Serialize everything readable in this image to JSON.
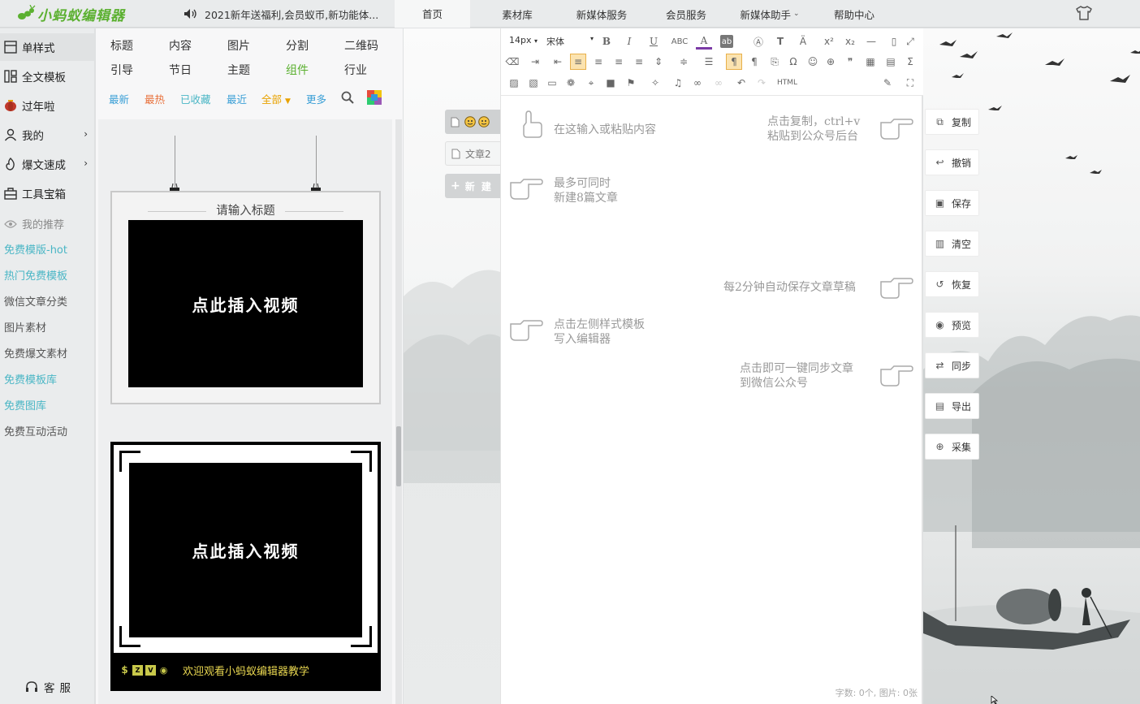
{
  "app": {
    "logo_text": "小蚂蚁编辑器",
    "notice": "2021新年送福利,会员蚁币,新功能体..."
  },
  "topnav": [
    {
      "label": "首页",
      "active": true
    },
    {
      "label": "素材库"
    },
    {
      "label": "新媒体服务"
    },
    {
      "label": "会员服务"
    },
    {
      "label": "新媒体助手",
      "dropdown": true
    },
    {
      "label": "帮助中心"
    }
  ],
  "sidebar": {
    "items": [
      {
        "label": "单样式",
        "icon": "square-grid-icon"
      },
      {
        "label": "全文模板",
        "icon": "layout-icon"
      },
      {
        "label": "过年啦",
        "icon": "lantern-icon"
      },
      {
        "label": "我的",
        "icon": "user-icon",
        "arrow": "›"
      },
      {
        "label": "爆文速成",
        "icon": "fire-icon",
        "arrow": "›"
      },
      {
        "label": "工具宝箱",
        "icon": "toolbox-icon"
      }
    ],
    "links": [
      {
        "label": "我的推荐",
        "style": "lgray"
      },
      {
        "label": "免费模版-hot",
        "style": "teal"
      },
      {
        "label": "热门免费模板",
        "style": "teal"
      },
      {
        "label": "微信文章分类",
        "style": "gray"
      },
      {
        "label": "图片素材",
        "style": "gray"
      },
      {
        "label": "免费爆文素材",
        "style": "gray"
      },
      {
        "label": "免费模板库",
        "style": "teal"
      },
      {
        "label": "免费图库",
        "style": "teal"
      },
      {
        "label": "免费互动活动",
        "style": "gray"
      }
    ],
    "kefu": "客服"
  },
  "templates": {
    "categories": [
      "标题",
      "内容",
      "图片",
      "分割",
      "二维码",
      "引导",
      "节日",
      "主题",
      "组件",
      "行业"
    ],
    "filters": [
      {
        "label": "最新",
        "color": "#3a9fd6"
      },
      {
        "label": "最热",
        "color": "#e8703a"
      },
      {
        "label": "已收藏",
        "color": "#4ab6c5"
      },
      {
        "label": "最近",
        "color": "#3a9fd6"
      },
      {
        "label": "全部",
        "color": "#e8a200"
      },
      {
        "label": "更多",
        "color": "#3a9fd6"
      }
    ],
    "tpl1": {
      "title": "请输入标题",
      "video_label": "点此插入视频"
    },
    "tpl2": {
      "video_label": "点此插入视频",
      "caption": "欢迎观看小蚂蚁编辑器教学"
    }
  },
  "doc_tabs": [
    {
      "label": ""
    },
    {
      "label": "文章2"
    },
    {
      "label": "新 建"
    }
  ],
  "editor": {
    "font_size": "14px",
    "font_family": "宋体",
    "html_label": "HTML",
    "hints": [
      {
        "text": "在这输入或粘贴内容"
      },
      {
        "text": "点击复制，ctrl+v\n粘贴到公众号后台"
      },
      {
        "text": "最多可同时\n新建8篇文章"
      },
      {
        "text": "每2分钟自动保存文章草稿"
      },
      {
        "text": "点击左侧样式模板\n写入编辑器"
      },
      {
        "text": "点击即可一键同步文章\n到微信公众号"
      }
    ],
    "word_count": "字数: 0个, 图片: 0张"
  },
  "actions": [
    {
      "label": "复制",
      "icon": "copy-icon"
    },
    {
      "label": "撤销",
      "icon": "undo-icon"
    },
    {
      "label": "保存",
      "icon": "save-icon"
    },
    {
      "label": "清空",
      "icon": "trash-icon"
    },
    {
      "label": "恢复",
      "icon": "restore-icon"
    },
    {
      "label": "预览",
      "icon": "eye-icon"
    },
    {
      "label": "同步",
      "icon": "sync-icon"
    },
    {
      "label": "导出",
      "icon": "export-icon"
    },
    {
      "label": "采集",
      "icon": "search-icon"
    }
  ]
}
